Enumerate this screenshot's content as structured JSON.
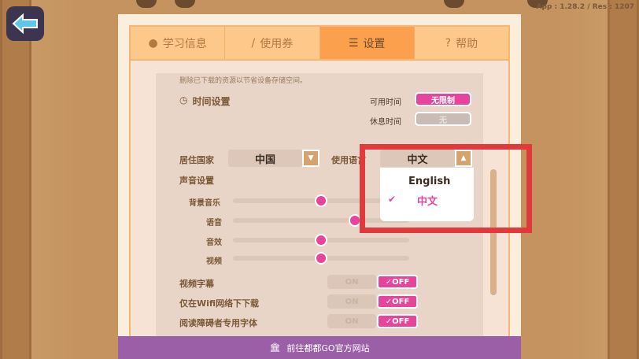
{
  "app_version": "App : 1.28.2 / Res : 1207",
  "tabs": [
    {
      "label": "学习信息",
      "icon": "user-icon"
    },
    {
      "label": "使用券",
      "icon": "pencil-icon"
    },
    {
      "label": "设置",
      "icon": "sliders-icon",
      "active": true
    },
    {
      "label": "帮助",
      "icon": "help-icon"
    }
  ],
  "delete_hint": "删除已下载的资源以节省设备存储空间。",
  "time": {
    "title": "时间设置",
    "available_label": "可用时间",
    "available_value": "无限制",
    "rest_label": "休息时间",
    "rest_value": "无"
  },
  "country": {
    "label": "居住国家",
    "value": "中国"
  },
  "language": {
    "label": "使用语言",
    "value": "中文",
    "options": [
      "English",
      "中文"
    ],
    "selected": "中文"
  },
  "sound": {
    "title": "声音设置",
    "sliders": [
      {
        "label": "背景音乐",
        "value": 0.5
      },
      {
        "label": "语音",
        "value": 0.69
      },
      {
        "label": "音效",
        "value": 0.5
      },
      {
        "label": "视频",
        "value": 0.5
      }
    ]
  },
  "toggles": [
    {
      "label": "视频字幕",
      "on": "ON",
      "off": "OFF"
    },
    {
      "label": "仅在Wifi网络下下载",
      "on": "ON",
      "off": "OFF"
    },
    {
      "label": "阅读障碍者专用字体",
      "on": "ON",
      "off": "OFF"
    }
  ],
  "bottom_link": "前往都都GO官方网站",
  "colors": {
    "accent": "#e8449b",
    "purple": "#9b5fa8",
    "highlight": "#e23a3a"
  }
}
